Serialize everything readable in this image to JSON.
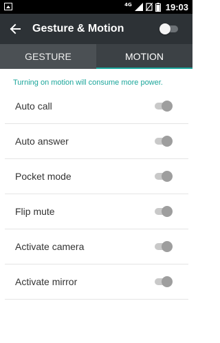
{
  "status_bar": {
    "network_type": "4G",
    "time": "19:03",
    "icons": [
      "image-notification-icon",
      "signal-icon",
      "no-sim-icon",
      "battery-icon"
    ]
  },
  "app_bar": {
    "title": "Gesture & Motion",
    "back_icon": "back-arrow-icon",
    "master_switch_on": false
  },
  "tabs": [
    {
      "label": "GESTURE",
      "selected": false
    },
    {
      "label": "MOTION",
      "selected": true
    }
  ],
  "info_text": "Turning on motion will consume more power.",
  "settings": [
    {
      "label": "Auto call",
      "enabled": false
    },
    {
      "label": "Auto answer",
      "enabled": false
    },
    {
      "label": "Pocket mode",
      "enabled": false
    },
    {
      "label": "Flip mute",
      "enabled": false
    },
    {
      "label": "Activate camera",
      "enabled": false
    },
    {
      "label": "Activate mirror",
      "enabled": false
    }
  ],
  "colors": {
    "status_bar": "#000000",
    "app_bar": "#2d3236",
    "tab_bar": "#3c4145",
    "accent": "#1aa59a",
    "switch_track_disabled": "#c9c9c9",
    "switch_thumb_disabled": "#9e9e9e"
  }
}
